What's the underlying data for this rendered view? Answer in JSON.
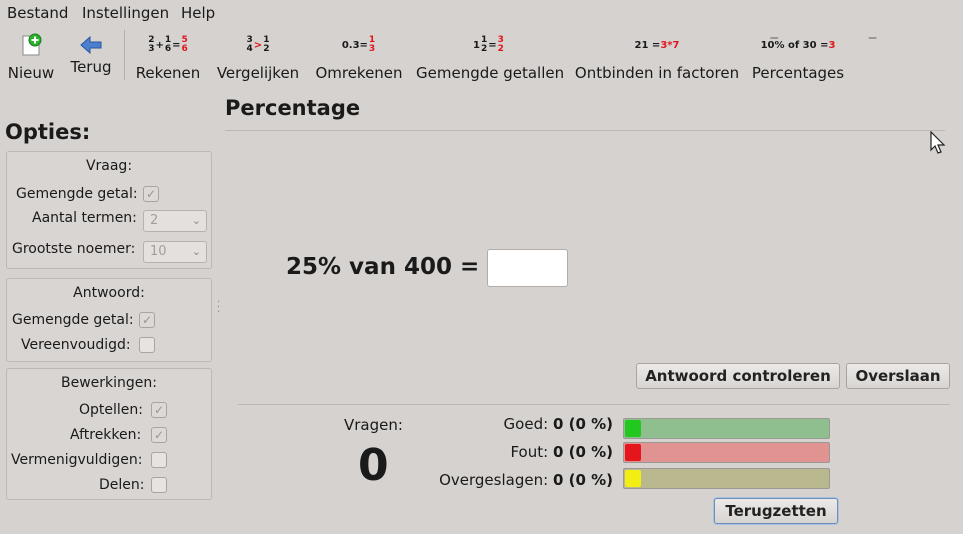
{
  "menu": {
    "file": "Bestand",
    "settings": "Instellingen",
    "help": "Help"
  },
  "toolbar": {
    "new_label": "Nieuw",
    "back_label": "Terug",
    "modes": [
      {
        "label": "Rekenen",
        "icon": "2/3 + 1/6 = 5/6"
      },
      {
        "label": "Vergelijken",
        "icon": "3/4 > 1/2"
      },
      {
        "label": "Omrekenen",
        "icon": "0.3 = 1/3"
      },
      {
        "label": "Gemengde getallen",
        "icon": "1 1/2 = 3/2"
      },
      {
        "label": "Ontbinden in factoren",
        "icon": "21 = 3*7"
      },
      {
        "label": "Percentages",
        "icon": "10% of 30 = 3"
      }
    ],
    "icons": {
      "rekenen": {
        "a_num": "2",
        "a_den": "3",
        "op": "+",
        "b_num": "1",
        "b_den": "6",
        "eq": "=",
        "r_num": "5",
        "r_den": "6"
      },
      "vergelijken": {
        "a_num": "3",
        "a_den": "4",
        "op": ">",
        "b_num": "1",
        "b_den": "2"
      },
      "omrekenen": {
        "lhs": "0.3",
        "eq": "=",
        "r_num": "1",
        "r_den": "3"
      },
      "gemengd": {
        "whole": "1",
        "a_num": "1",
        "a_den": "2",
        "eq": "=",
        "r_num": "3",
        "r_den": "2"
      },
      "factoren": {
        "lhs": "21 =",
        "rhs": "3*7"
      },
      "percentages": {
        "lhs": "10% of 30 =",
        "rhs": "3"
      }
    }
  },
  "options": {
    "title": "Opties:",
    "question": {
      "title": "Vraag:",
      "mixed_label": "Gemengde getal:",
      "mixed_checked": true,
      "terms_label": "Aantal termen:",
      "terms_value": "2",
      "denominator_label": "Grootste noemer:",
      "denominator_value": "10"
    },
    "answer": {
      "title": "Antwoord:",
      "mixed_label": "Gemengde getal:",
      "mixed_checked": true,
      "simplified_label": "Vereenvoudigd:",
      "simplified_checked": false
    },
    "operations": {
      "title": "Bewerkingen:",
      "add_label": "Optellen:",
      "add_checked": true,
      "sub_label": "Aftrekken:",
      "sub_checked": true,
      "mul_label": "Vermenigvuldigen:",
      "mul_checked": false,
      "div_label": "Delen:",
      "div_checked": false
    }
  },
  "main": {
    "title": "Percentage",
    "question": "25% van 400 =",
    "answer_value": "",
    "check_button": "Antwoord controleren",
    "skip_button": "Overslaan"
  },
  "stats": {
    "questions_label": "Vragen:",
    "questions_value": "0",
    "correct_label": "Goed:",
    "correct_value": "0 (0 %)",
    "correct_fraction": 0,
    "wrong_label": "Fout:",
    "wrong_value": "0 (0 %)",
    "wrong_fraction": 0,
    "skipped_label": "Overgeslagen:",
    "skipped_value": "0 (0 %)",
    "skipped_fraction": 0,
    "reset_button": "Terugzetten"
  },
  "colors": {
    "correct_track": "#8fbf8f",
    "correct_knob": "#22c81e",
    "wrong_track": "#e09390",
    "wrong_knob": "#e4161b",
    "skipped_track": "#b9b88e",
    "skipped_knob": "#f2ee14"
  }
}
